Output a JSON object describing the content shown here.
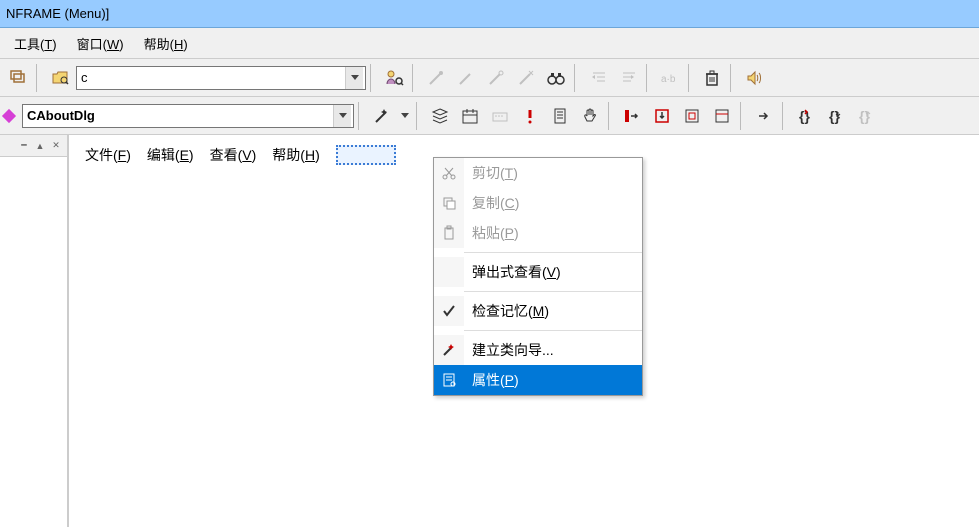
{
  "title": "NFRAME (Menu)]",
  "menubar": {
    "tools": "工具(T)",
    "window": "窗口(W)",
    "help": "帮助(H)"
  },
  "toolbar1": {
    "combo_value": "c",
    "class_combo_value": "CAboutDlg"
  },
  "editor_menu": {
    "file": "文件(F)",
    "edit": "编辑(E)",
    "view": "查看(V)",
    "help": "帮助(H)"
  },
  "context_menu": {
    "cut": "剪切(T)",
    "copy": "复制(C)",
    "paste": "粘贴(P)",
    "popup_view": "弹出式查看(V)",
    "check_memory": "检查记忆(M)",
    "class_wizard": "建立类向导...",
    "properties": "属性(P)"
  }
}
